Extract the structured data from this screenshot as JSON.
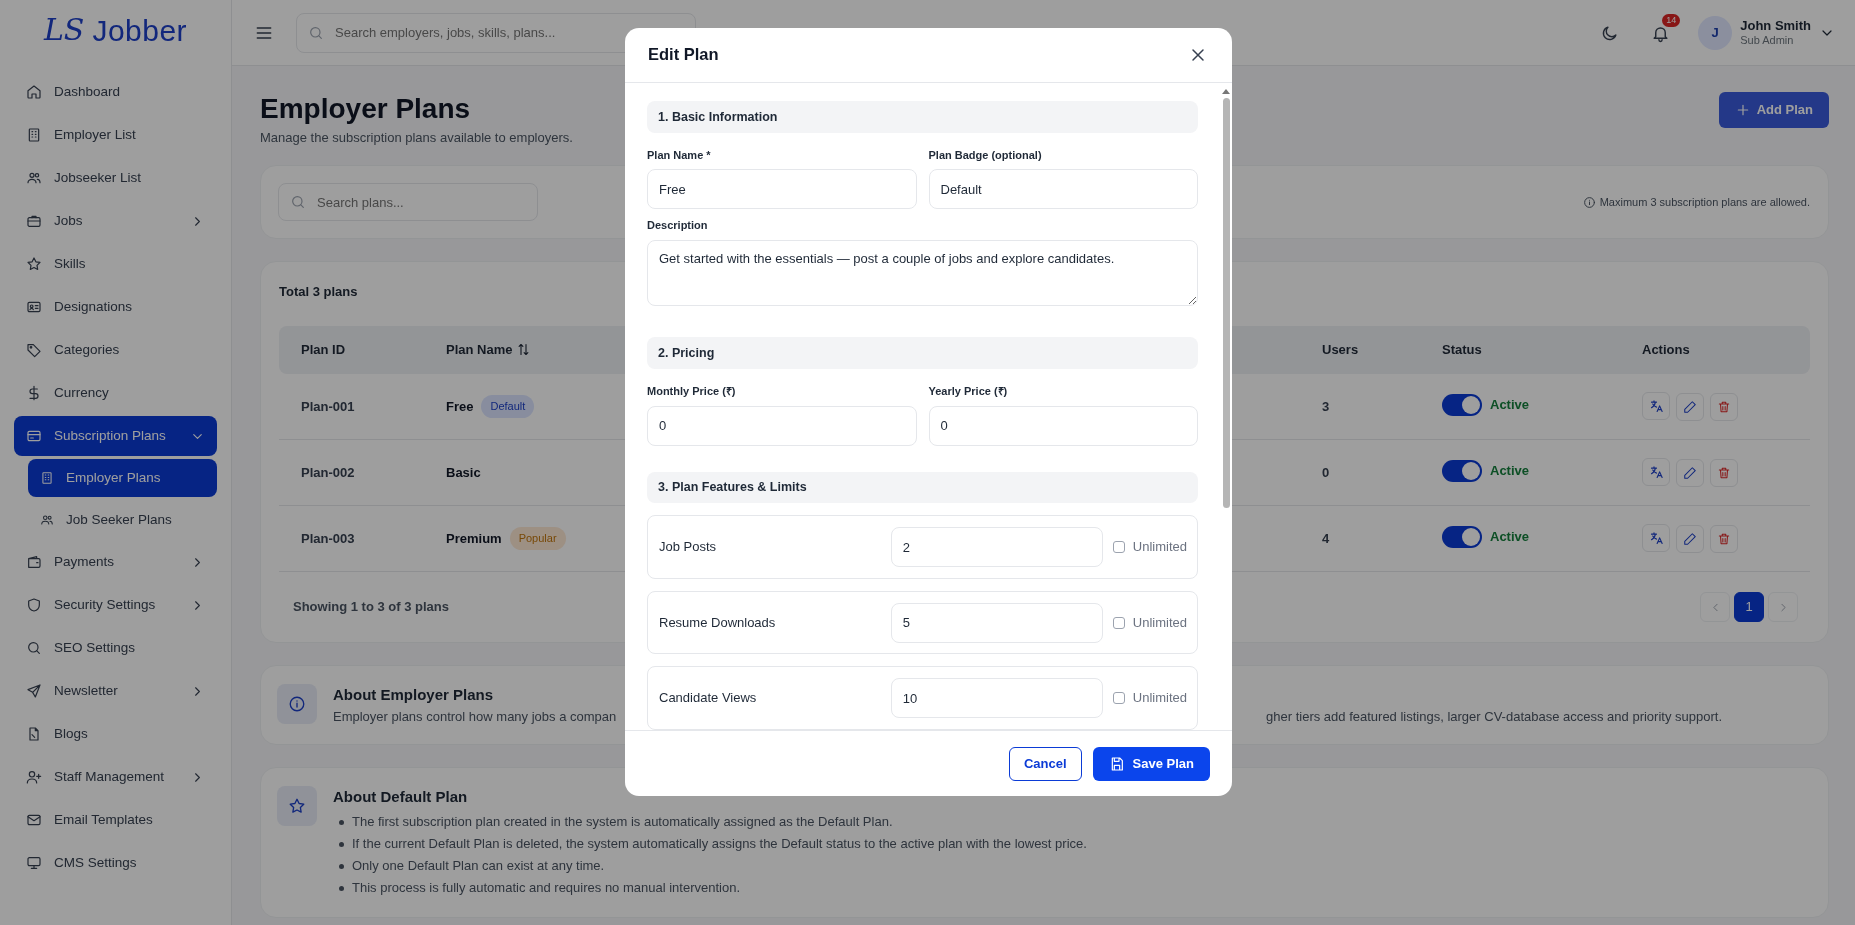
{
  "sidebar": {
    "logo": {
      "mark": "LS",
      "name": "Jobber"
    },
    "items": [
      {
        "label": "Dashboard",
        "selected": false
      },
      {
        "label": "Employer List",
        "selected": false
      },
      {
        "label": "Jobseeker List",
        "selected": false
      },
      {
        "label": "Jobs",
        "expanded": false,
        "selected": false
      },
      {
        "label": "Skills",
        "selected": false
      },
      {
        "label": "Designations",
        "selected": false
      },
      {
        "label": "Categories",
        "selected": false
      },
      {
        "label": "Currency",
        "selected": false
      },
      {
        "label": "Subscription Plans",
        "expanded": true,
        "selected": true,
        "children": [
          {
            "label": "Employer Plans",
            "selected": true
          },
          {
            "label": "Job Seeker Plans",
            "selected": false
          }
        ]
      },
      {
        "label": "Payments",
        "expanded": false,
        "selected": false
      },
      {
        "label": "Security Settings",
        "expanded": false,
        "selected": false
      },
      {
        "label": "SEO Settings",
        "selected": false
      },
      {
        "label": "Newsletter",
        "expanded": false,
        "selected": false
      },
      {
        "label": "Blogs",
        "selected": false
      },
      {
        "label": "Staff Management",
        "expanded": false,
        "selected": false
      },
      {
        "label": "Email Templates",
        "selected": false
      },
      {
        "label": "CMS Settings",
        "selected": false
      }
    ]
  },
  "header": {
    "search": {
      "placeholder": "Search employers, jobs, skills, plans..."
    },
    "notifications": "14",
    "user": {
      "initial": "J",
      "name": "John Smith",
      "role": "Sub Admin"
    }
  },
  "page": {
    "title": "Employer Plans",
    "subtitle": "Manage the subscription plans available to employers.",
    "add_button": "Add Plan"
  },
  "filter": {
    "search": {
      "placeholder": "Search plans..."
    },
    "note": "Maximum 3 subscription plans are allowed."
  },
  "table": {
    "total": "Total 3 plans",
    "columns": [
      {
        "label": "Plan ID",
        "sortable": false
      },
      {
        "label": "Plan Name",
        "sortable": true
      },
      {
        "label": "Users",
        "sortable": false
      },
      {
        "label": "Status",
        "sortable": false
      },
      {
        "label": "Actions",
        "sortable": false
      }
    ],
    "rows": [
      {
        "id": "Plan-001",
        "name": "Free",
        "badge": {
          "text": "Default",
          "kind": "default"
        },
        "users": "3",
        "active": true,
        "status": "Active"
      },
      {
        "id": "Plan-002",
        "name": "Basic",
        "users": "0",
        "active": true,
        "status": "Active"
      },
      {
        "id": "Plan-003",
        "name": "Premium",
        "badge": {
          "text": "Popular",
          "kind": "popular"
        },
        "users": "4",
        "active": true,
        "status": "Active"
      }
    ],
    "showing": "Showing 1 to 3 of 3 plans",
    "pages": [
      {
        "label": "1",
        "selected": true
      }
    ]
  },
  "about_employer": {
    "title": "About Employer Plans",
    "text_left": "Employer plans control how many jobs a compan",
    "text_right": "gher tiers add featured listings, larger CV-database access and priority support."
  },
  "about_default": {
    "title": "About Default Plan",
    "points": [
      "The first subscription plan created in the system is automatically assigned as the Default Plan.",
      "If the current Default Plan is deleted, the system automatically assigns the Default status to the active plan with the lowest price.",
      "Only one Default Plan can exist at any time.",
      "This process is fully automatic and requires no manual intervention."
    ]
  },
  "modal": {
    "title": "Edit Plan",
    "sections": [
      {
        "title": "1. Basic Information",
        "fields": [
          {
            "label": "Plan Name *",
            "value": "Free",
            "kind": "input"
          },
          {
            "label": "Plan Badge (optional)",
            "value": "Default",
            "kind": "input"
          },
          {
            "label": "Description",
            "value": "Get started with the essentials — post a couple of jobs and explore candidates.",
            "kind": "textarea"
          }
        ]
      },
      {
        "title": "2. Pricing",
        "fields": [
          {
            "label": "Monthly Price (₹)",
            "value": "0",
            "kind": "input"
          },
          {
            "label": "Yearly Price (₹)",
            "value": "0",
            "kind": "input"
          }
        ]
      },
      {
        "title": "3. Plan Features & Limits",
        "features": [
          {
            "label": "Job Posts",
            "value": "2",
            "unlimited": false,
            "unlimited_label": "Unlimited"
          },
          {
            "label": "Resume Downloads",
            "value": "5",
            "unlimited": false,
            "unlimited_label": "Unlimited"
          },
          {
            "label": "Candidate Views",
            "value": "10",
            "unlimited": false,
            "unlimited_label": "Unlimited"
          }
        ]
      }
    ],
    "cancel": "Cancel",
    "save": "Save Plan"
  }
}
